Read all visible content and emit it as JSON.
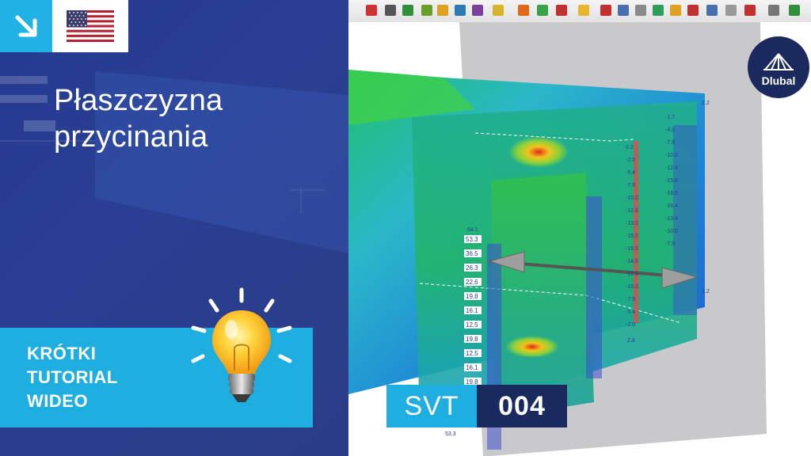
{
  "title": {
    "line1": "Płaszczyzna",
    "line2": "przycinania"
  },
  "tutorial": {
    "line1": "KRÓTKI",
    "line2": "TUTORIAL",
    "line3": "WIDEO"
  },
  "code": {
    "series": "SVT",
    "number": "004"
  },
  "logo": {
    "name": "Dlubal"
  },
  "language_icon": "us-flag-icon",
  "corner_icon": "arrow-down-right-icon",
  "bulb_icon": "lightbulb-icon",
  "colors": {
    "panel_blue": "#2a3f94",
    "accent_cyan": "#1eaee0",
    "dark_navy": "#1b2a5e"
  },
  "left_labels": [
    "53.3",
    "36.5",
    "26.3",
    "22.6",
    "19.8",
    "16.1",
    "12.5",
    "19.8",
    "12.5",
    "16.1",
    "19.8"
  ],
  "right_labels": [
    "-1.7",
    "-4.0",
    "-7.9",
    "-10.0",
    "-12.4",
    "-15.6",
    "-16.6",
    "-16.4",
    "-13.4",
    "-10.0",
    "-7.9"
  ],
  "inner_labels": [
    "0.2",
    "-2.0",
    "-5.4",
    "-7.5",
    "-10.2",
    "-12.6",
    "-13.5",
    "-15.5",
    "-15.5",
    "-14.5",
    "-12.6",
    "-10.2",
    "-7.9",
    "-5.4",
    "-2.0"
  ],
  "tick_labels": {
    "top_right": "1.2",
    "mid_right": "1.2",
    "lower_right": "2.6",
    "bottom_left": "53.3",
    "mid_left": "64.1"
  }
}
